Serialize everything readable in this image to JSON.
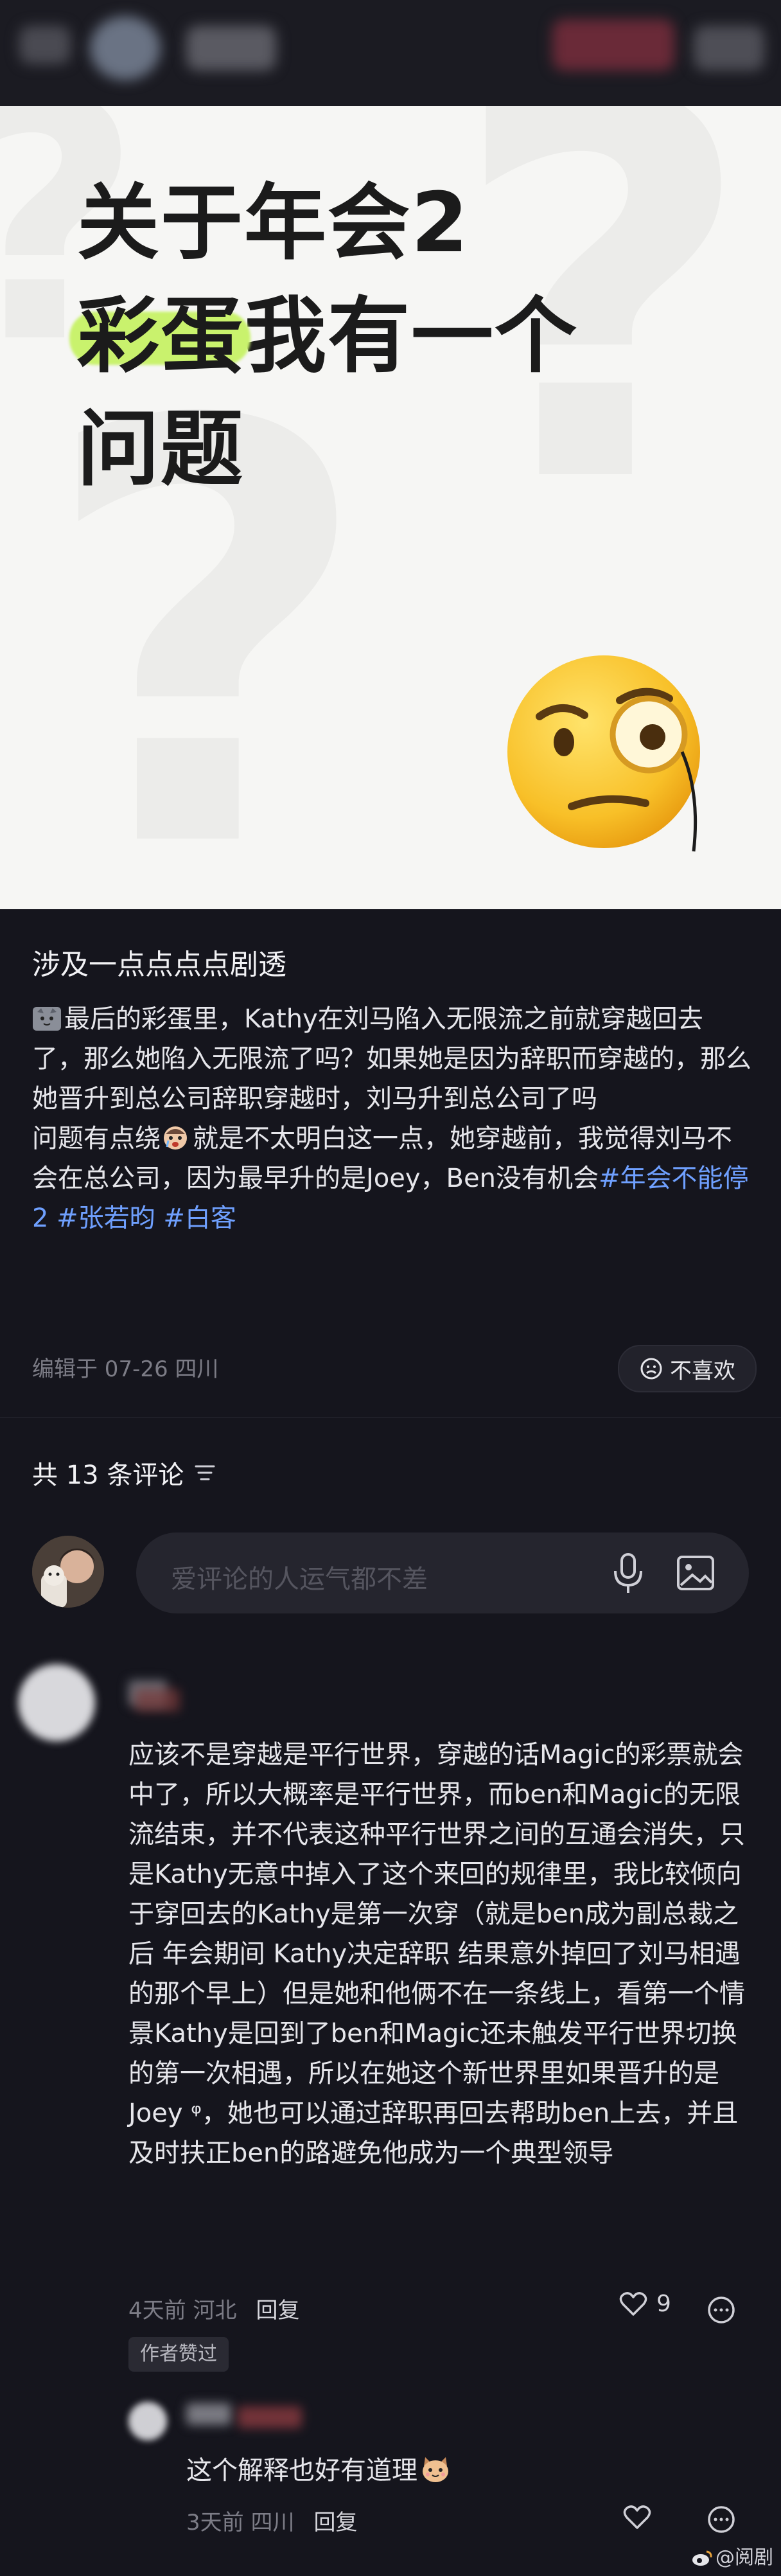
{
  "hero": {
    "title_line1": "关于年会2",
    "title_highlight": "彩蛋",
    "title_line2_rest": "我有一个",
    "title_line3": "问题",
    "emoji_icon": "face-with-monocle-icon",
    "highlight_color": "#c9f26d"
  },
  "post": {
    "title": "涉及一点点点点剧透",
    "para1": "最后的彩蛋里，Kathy在刘马陷入无限流之前就穿越回去了，那么她陷入无限流了吗？如果她是因为辞职而穿越的，那么她晋升到总公司辞职穿越时，刘马升到总公司了吗",
    "para2_a": "问题有点绕",
    "para2_b": "就是不太明白这一点，她穿越前，我觉得刘马不会在总公司，因为最早升的是Joey，Ben没有机会",
    "tags": [
      "#年会不能停2",
      "#张若昀",
      "#白客"
    ],
    "meta": "编辑于  07-26 四川",
    "dislike_label": "不喜欢"
  },
  "comments_header": {
    "count_label": "共 13 条评论"
  },
  "composer": {
    "placeholder": "爱评论的人运气都不差"
  },
  "comment1": {
    "text": "应该不是穿越是平行世界，穿越的话Magic的彩票就会中了，所以大概率是平行世界，而ben和Magic的无限流结束，并不代表这种平行世界之间的互通会消失，只是Kathy无意中掉入了这个来回的规律里，我比较倾向于穿回去的Kathy是第一次穿（就是ben成为副总裁之后 年会期间 Kathy决定辞职 结果意外掉回了刘马相遇的那个早上）但是她和他俩不在一条线上，看第一个情景Kathy是回到了ben和Magic还未触发平行世界切换的第一次相遇，所以在她这个新世界里如果晋升的是 Joey ᵠ，她也可以通过辞职再回去帮助ben上去，并且及时扶正ben的路避免他成为一个典型领导",
    "time_location": "4天前 河北",
    "reply_label": "回复",
    "likes": "9",
    "author_badge": "作者赞过"
  },
  "comment2": {
    "text": "这个解释也好有道理",
    "time_location": "3天前 四川",
    "reply_label": "回复"
  },
  "watermark": {
    "text": "@阅剧"
  }
}
